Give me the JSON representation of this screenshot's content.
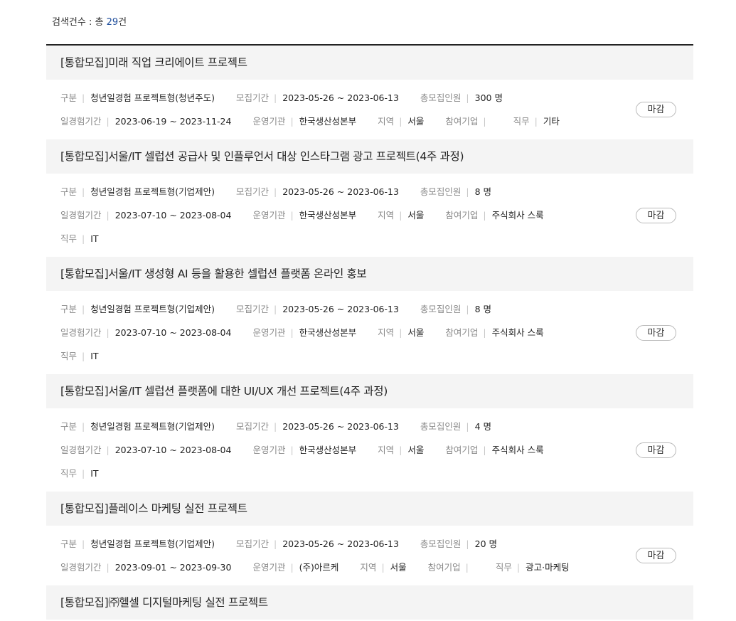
{
  "search_count": {
    "label": "검색건수 : 총",
    "number": "29",
    "suffix": "건"
  },
  "labels": {
    "category": "구분",
    "recruit_period": "모집기간",
    "total_recruits": "총모집인원",
    "experience_period": "일경험기간",
    "operator": "운영기관",
    "region": "지역",
    "company": "참여기업",
    "job": "직무",
    "separator": "|"
  },
  "items": [
    {
      "title": "[통합모집]미래 직업 크리에이트 프로젝트",
      "category": "청년일경험 프로젝트형(청년주도)",
      "recruit_period": "2023-05-26 ~ 2023-06-13",
      "total_recruits": "300 명",
      "experience_period": "2023-06-19 ~ 2023-11-24",
      "operator": "한국생산성본부",
      "region": "서울",
      "company": "",
      "job": "기타",
      "status": "마감"
    },
    {
      "title": "[통합모집]서울/IT 셀럽션 공급사 및 인플루언서 대상 인스타그램 광고 프로젝트(4주 과정)",
      "category": "청년일경험 프로젝트형(기업제안)",
      "recruit_period": "2023-05-26 ~ 2023-06-13",
      "total_recruits": "8 명",
      "experience_period": "2023-07-10 ~ 2023-08-04",
      "operator": "한국생산성본부",
      "region": "서울",
      "company": "주식회사 스룩",
      "job": "IT",
      "status": "마감"
    },
    {
      "title": "[통합모집]서울/IT 생성형 AI 등을 활용한 셀럽션 플랫폼 온라인 홍보",
      "category": "청년일경험 프로젝트형(기업제안)",
      "recruit_period": "2023-05-26 ~ 2023-06-13",
      "total_recruits": "8 명",
      "experience_period": "2023-07-10 ~ 2023-08-04",
      "operator": "한국생산성본부",
      "region": "서울",
      "company": "주식회사 스룩",
      "job": "IT",
      "status": "마감"
    },
    {
      "title": "[통합모집]서울/IT 셀럽션 플랫폼에 대한 UI/UX 개선 프로젝트(4주 과정)",
      "category": "청년일경험 프로젝트형(기업제안)",
      "recruit_period": "2023-05-26 ~ 2023-06-13",
      "total_recruits": "4 명",
      "experience_period": "2023-07-10 ~ 2023-08-04",
      "operator": "한국생산성본부",
      "region": "서울",
      "company": "주식회사 스룩",
      "job": "IT",
      "status": "마감"
    },
    {
      "title": "[통합모집]플레이스 마케팅 실전 프로젝트",
      "category": "청년일경험 프로젝트형(기업제안)",
      "recruit_period": "2023-05-26 ~ 2023-06-13",
      "total_recruits": "20 명",
      "experience_period": "2023-09-01 ~ 2023-09-30",
      "operator": "(주)아르케",
      "region": "서울",
      "company": "",
      "job": "광고·마케팅",
      "status": "마감"
    }
  ],
  "partial_item": {
    "title": "[통합모집]㈜헬셀 디지털마케팅 실전 프로젝트"
  }
}
